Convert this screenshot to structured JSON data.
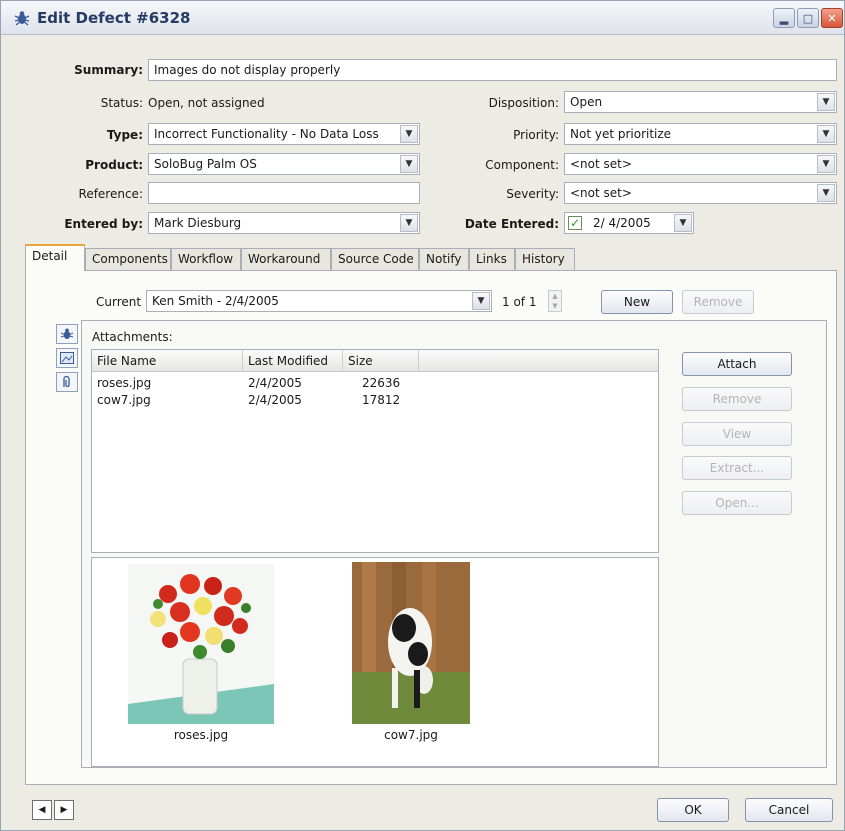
{
  "window": {
    "title": "Edit Defect #6328"
  },
  "form": {
    "summary_label": "Summary:",
    "summary_value": "Images do not display properly",
    "status_label": "Status:",
    "status_value": "Open, not assigned",
    "type_label": "Type:",
    "type_value": "Incorrect Functionality - No Data Loss",
    "product_label": "Product:",
    "product_value": "SoloBug Palm OS",
    "reference_label": "Reference:",
    "reference_value": "",
    "entered_by_label": "Entered by:",
    "entered_by_value": "Mark Diesburg",
    "disposition_label": "Disposition:",
    "disposition_value": "Open",
    "priority_label": "Priority:",
    "priority_value": "Not yet prioritize",
    "component_label": "Component:",
    "component_value": "<not set>",
    "severity_label": "Severity:",
    "severity_value": "<not set>",
    "date_entered_label": "Date Entered:",
    "date_entered_value": "2/ 4/2005",
    "date_entered_checked": true
  },
  "tabs": [
    {
      "label": "Detail",
      "active": true
    },
    {
      "label": "Components"
    },
    {
      "label": "Workflow"
    },
    {
      "label": "Workaround"
    },
    {
      "label": "Source Code"
    },
    {
      "label": "Notify"
    },
    {
      "label": "Links"
    },
    {
      "label": "History"
    }
  ],
  "detail": {
    "current_label": "Current",
    "current_value": "Ken Smith - 2/4/2005",
    "record_count": "1 of 1",
    "new_label": "New",
    "remove_label": "Remove"
  },
  "attachments": {
    "title": "Attachments:",
    "columns": [
      "File Name",
      "Last Modified",
      "Size"
    ],
    "rows": [
      {
        "name": "roses.jpg",
        "modified": "2/4/2005",
        "size": "22636"
      },
      {
        "name": "cow7.jpg",
        "modified": "2/4/2005",
        "size": "17812"
      }
    ],
    "buttons": {
      "attach": "Attach",
      "remove": "Remove",
      "view": "View",
      "extract": "Extract...",
      "open": "Open..."
    },
    "previews": [
      {
        "caption": "roses.jpg"
      },
      {
        "caption": "cow7.jpg"
      }
    ]
  },
  "footer": {
    "ok_label": "OK",
    "cancel_label": "Cancel"
  },
  "colors": {
    "accent_tab": "#e8a43a",
    "title_text": "#263a66",
    "window_bg": "#ecebe4"
  }
}
